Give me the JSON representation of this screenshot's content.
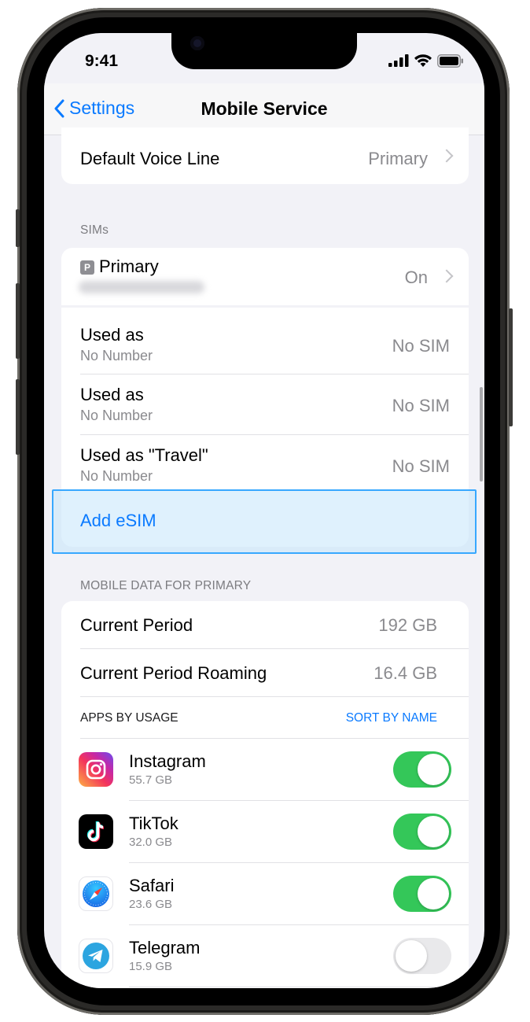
{
  "status_bar": {
    "time": "9:41"
  },
  "nav": {
    "back_label": "Settings",
    "title": "Mobile Service"
  },
  "default_voice": {
    "label": "Default Voice Line",
    "value": "Primary"
  },
  "sims": {
    "header": "SIMs",
    "primary": {
      "badge": "P",
      "label": "Primary",
      "value": "On"
    },
    "items": [
      {
        "label": "Used as",
        "sub": "No Number",
        "value": "No SIM"
      },
      {
        "label": "Used as",
        "sub": "No Number",
        "value": "No SIM"
      },
      {
        "label": "Used as \"Travel\"",
        "sub": "No Number",
        "value": "No SIM"
      }
    ],
    "add_esim": "Add eSIM"
  },
  "mobile_data": {
    "header": "MOBILE DATA FOR PRIMARY",
    "current_period": {
      "label": "Current Period",
      "value": "192 GB"
    },
    "current_period_roaming": {
      "label": "Current Period Roaming",
      "value": "16.4 GB"
    },
    "apps_header": "APPS BY USAGE",
    "sort_label": "SORT BY NAME",
    "apps": [
      {
        "name": "Instagram",
        "size": "55.7 GB",
        "enabled": true,
        "icon": "instagram-icon"
      },
      {
        "name": "TikTok",
        "size": "32.0 GB",
        "enabled": true,
        "icon": "tiktok-icon"
      },
      {
        "name": "Safari",
        "size": "23.6 GB",
        "enabled": true,
        "icon": "safari-icon"
      },
      {
        "name": "Telegram",
        "size": "15.9 GB",
        "enabled": false,
        "icon": "telegram-icon"
      }
    ]
  },
  "colors": {
    "accent": "#0a7aff",
    "toggle_on": "#34c759",
    "highlight": "#38a8ff"
  }
}
